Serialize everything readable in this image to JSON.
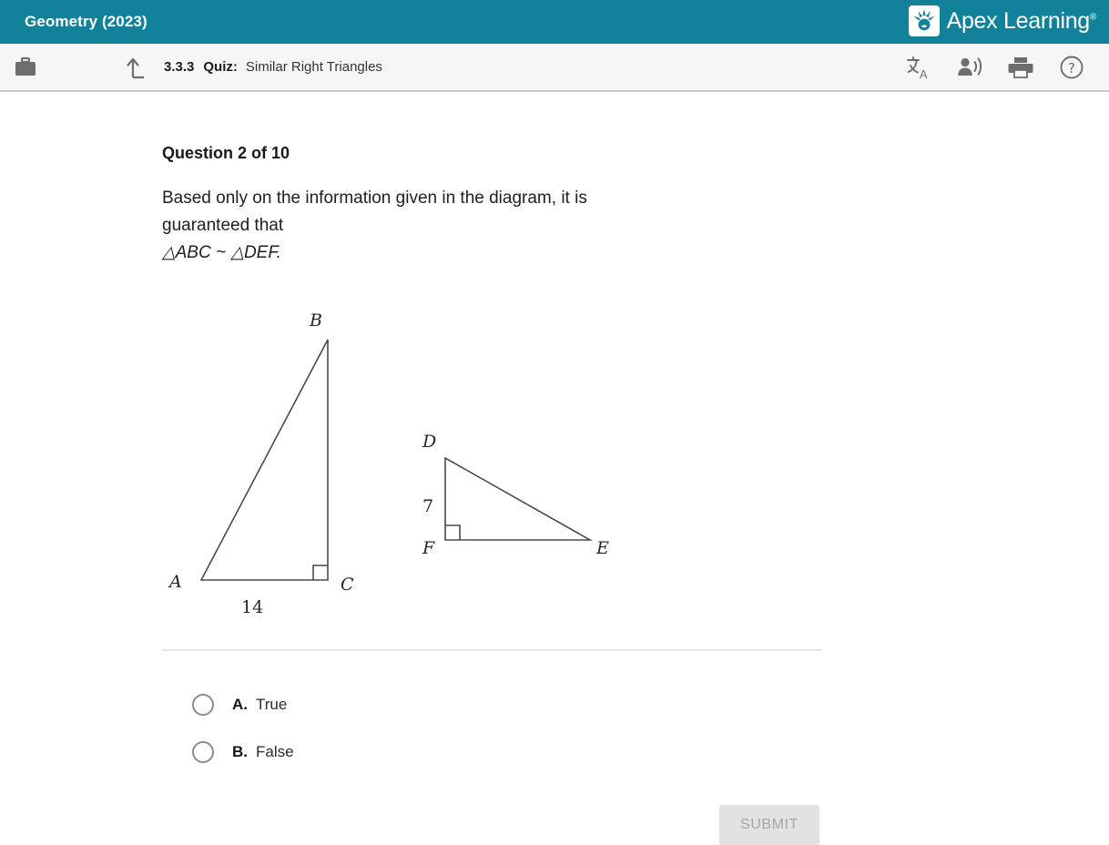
{
  "header": {
    "course_title": "Geometry (2023)",
    "brand_name": "Apex Learning",
    "brand_tm": "®",
    "brand_mark_icon": "apex-sunburst-logo-icon",
    "bg_color": "#11829a"
  },
  "toolbar": {
    "briefcase_icon": "briefcase-icon",
    "uplevel_icon": "up-one-level-arrow-icon",
    "lesson_number": "3.3.3",
    "lesson_type": "Quiz:",
    "lesson_name": "Similar Right Triangles",
    "icons": [
      {
        "name": "translate-icon",
        "glyph": "文"
      },
      {
        "name": "read-aloud-icon",
        "glyph": ""
      },
      {
        "name": "print-icon",
        "glyph": ""
      },
      {
        "name": "help-icon",
        "glyph": "?"
      }
    ]
  },
  "question": {
    "heading": "Question 2 of 10",
    "prompt_line1": "Based only on the information given in the diagram, it is",
    "prompt_line2": "guaranteed that",
    "prompt_math": "△ABC ~ △DEF."
  },
  "diagram": {
    "triangle_abc": {
      "vertices": {
        "A": "A",
        "B": "B",
        "C": "C"
      },
      "side_label_ac": "14",
      "right_angle_at": "C"
    },
    "triangle_def": {
      "vertices": {
        "D": "D",
        "E": "E",
        "F": "F"
      },
      "side_label_df": "7",
      "right_angle_at": "F"
    },
    "stroke_color": "#4a4a4a"
  },
  "choices": [
    {
      "letter": "A.",
      "text": "True",
      "selected": false
    },
    {
      "letter": "B.",
      "text": "False",
      "selected": false
    }
  ],
  "footer": {
    "submit_label": "SUBMIT",
    "submit_disabled": true
  }
}
